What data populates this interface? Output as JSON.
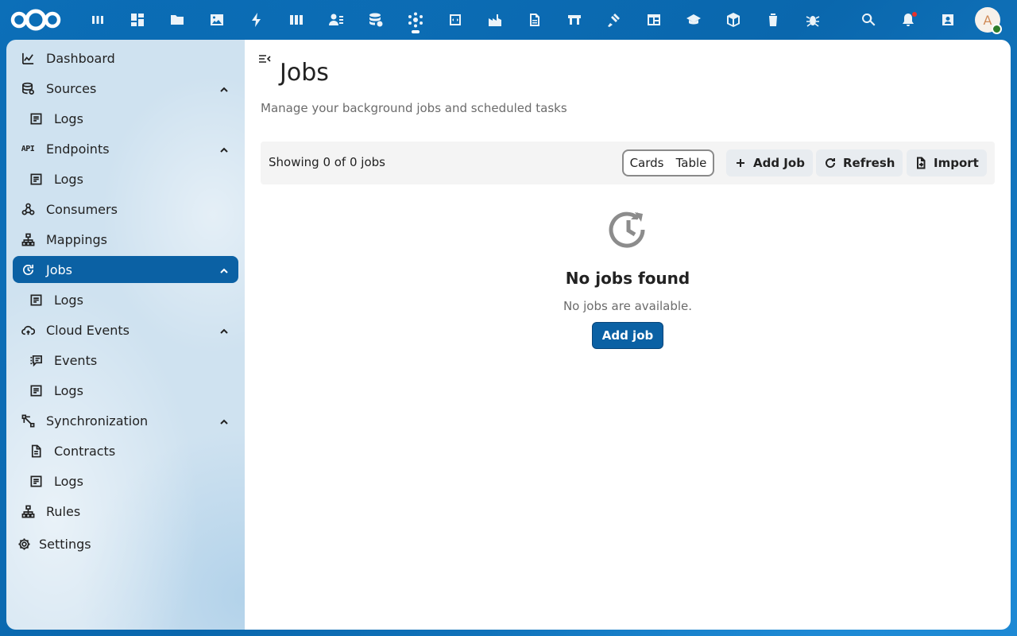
{
  "topbar": {
    "apps": [
      {
        "name": "deck-icon"
      },
      {
        "name": "dashboard-icon"
      },
      {
        "name": "files-icon"
      },
      {
        "name": "photos-icon"
      },
      {
        "name": "activity-icon"
      },
      {
        "name": "deck-boards-icon"
      },
      {
        "name": "contacts-icon"
      },
      {
        "name": "database-icon"
      },
      {
        "name": "openconnector-icon",
        "active": true
      },
      {
        "name": "code-icon"
      },
      {
        "name": "factory-icon"
      },
      {
        "name": "document-icon"
      },
      {
        "name": "flag-icon"
      },
      {
        "name": "gavel-icon"
      },
      {
        "name": "tables-icon"
      },
      {
        "name": "education-icon"
      },
      {
        "name": "package-icon"
      },
      {
        "name": "trash-icon"
      },
      {
        "name": "bug-icon"
      }
    ],
    "avatar_initial": "A"
  },
  "sidebar": {
    "items": [
      {
        "label": "Dashboard",
        "icon": "chart-icon",
        "level": 0
      },
      {
        "label": "Sources",
        "icon": "database-icon",
        "level": 0,
        "expandable": true
      },
      {
        "label": "Logs",
        "icon": "log-icon",
        "level": 1
      },
      {
        "label": "Endpoints",
        "icon": "api-icon",
        "level": 0,
        "expandable": true
      },
      {
        "label": "Logs",
        "icon": "log-icon",
        "level": 1
      },
      {
        "label": "Consumers",
        "icon": "webhook-icon",
        "level": 0
      },
      {
        "label": "Mappings",
        "icon": "sitemap-icon",
        "level": 0
      },
      {
        "label": "Jobs",
        "icon": "update-icon",
        "level": 0,
        "expandable": true,
        "active": true
      },
      {
        "label": "Logs",
        "icon": "log-icon",
        "level": 1
      },
      {
        "label": "Cloud Events",
        "icon": "cloud-sync-icon",
        "level": 0,
        "expandable": true
      },
      {
        "label": "Events",
        "icon": "message-list-icon",
        "level": 1
      },
      {
        "label": "Logs",
        "icon": "log-icon",
        "level": 1
      },
      {
        "label": "Synchronization",
        "icon": "vector-link-icon",
        "level": 0,
        "expandable": true
      },
      {
        "label": "Contracts",
        "icon": "file-document-icon",
        "level": 1
      },
      {
        "label": "Logs",
        "icon": "log-icon",
        "level": 1
      },
      {
        "label": "Rules",
        "icon": "sitemap-icon",
        "level": 0
      }
    ],
    "settings_label": "Settings"
  },
  "main": {
    "title": "Jobs",
    "subtitle": "Manage your background jobs and scheduled tasks",
    "count_text": "Showing 0 of 0 jobs",
    "view_toggle": [
      "Cards",
      "Table"
    ],
    "buttons": {
      "add": "Add Job",
      "refresh": "Refresh",
      "import": "Import"
    },
    "empty": {
      "title": "No jobs found",
      "text": "No jobs are available.",
      "button": "Add job"
    }
  },
  "colors": {
    "header_bg": "#0b6fb8",
    "primary": "#0b61a4",
    "toolbar_bg": "#f4f4f4"
  }
}
